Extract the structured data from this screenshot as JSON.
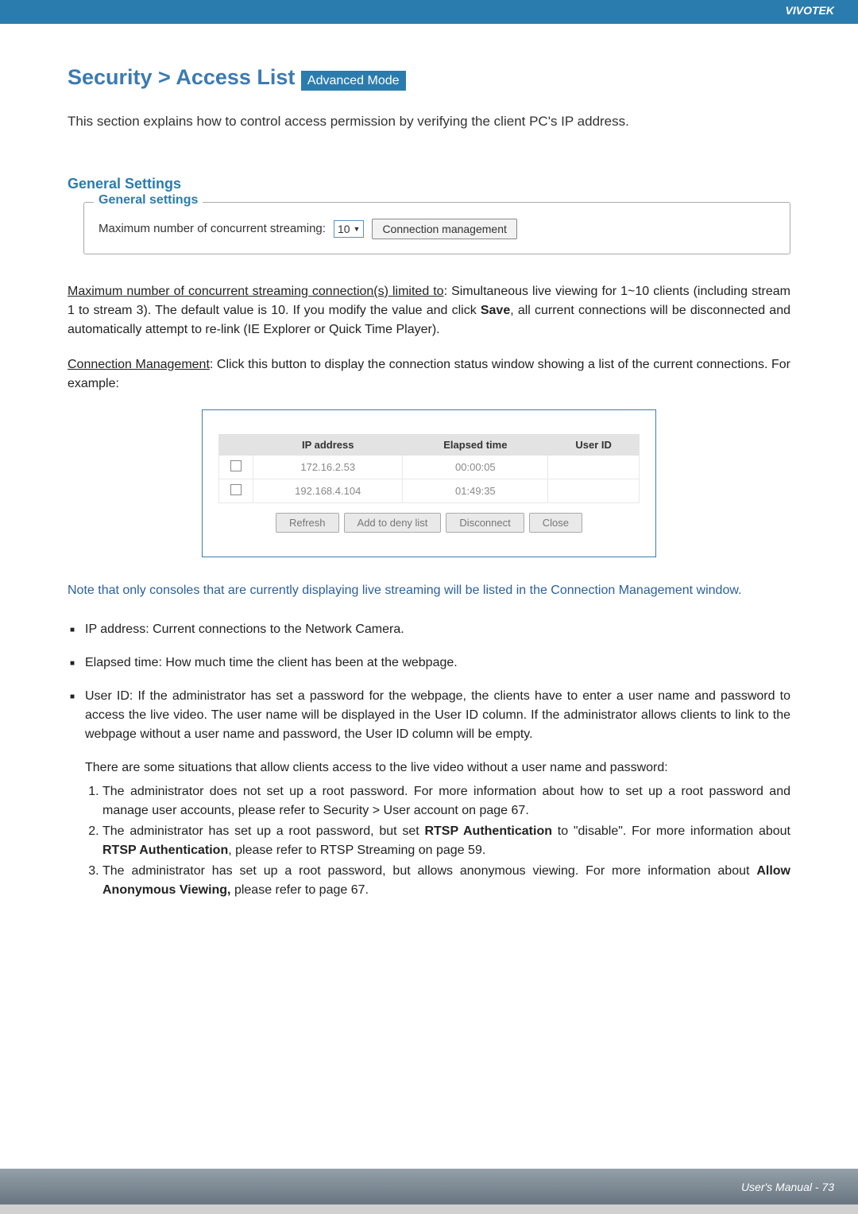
{
  "brand": "VIVOTEK",
  "title_prefix": "Security >  Access List ",
  "adv_mode": "Advanced Mode",
  "intro": "This section explains how to control access permission by verifying the client PC's IP address.",
  "general_settings": {
    "heading": "General Settings",
    "legend": "General settings",
    "label": "Maximum number of concurrent streaming:",
    "value": "10",
    "button": "Connection management"
  },
  "max_para_u": "Maximum number of concurrent streaming connection(s) limited to",
  "max_para_rest": ": Simultaneous live viewing for 1~10 clients (including stream 1 to stream 3). The default value is 10. If you modify the value and click ",
  "save_word": "Save",
  "max_para_tail": ", all current connections will be disconnected and automatically attempt to re-link (IE Explorer or Quick Time Player).",
  "conn_mgmt_u": "Connection Management",
  "conn_mgmt_rest": ": Click this button to display the connection status window showing a list of the current connections. For example:",
  "table": {
    "headers": [
      "",
      "IP address",
      "Elapsed time",
      "User ID"
    ],
    "rows": [
      {
        "ip": "172.16.2.53",
        "elapsed": "00:00:05",
        "user": ""
      },
      {
        "ip": "192.168.4.104",
        "elapsed": "01:49:35",
        "user": ""
      }
    ],
    "buttons": [
      "Refresh",
      "Add to deny list",
      "Disconnect",
      "Close"
    ]
  },
  "note": "Note that only consoles that are currently displaying live streaming will be listed in the Connection Management window.",
  "bullets": {
    "ip": "IP address: Current connections to the Network Camera.",
    "elapsed": "Elapsed time: How much time the client has been at the webpage.",
    "userid": "User ID: If the administrator has set a password for the webpage, the clients have to enter a user name and password to access the live video. The user name will be displayed in the User ID column. If  the administrator allows clients to link to the webpage without a user name and password, the User ID column will be empty."
  },
  "situations_intro": "There are some situations that allow clients access to the live video without a user name and password:",
  "num": {
    "1": "The administrator does not set up a root password. For more information about how to set up a root password and manage user accounts, please refer to Security > User account on page 67.",
    "2a": "The administrator has set up a root password, but set ",
    "2b": "RTSP Authentication",
    "2c": " to \"disable\". For more information about ",
    "2d": "RTSP Authentication",
    "2e": ", please refer to RTSP Streaming on page 59.",
    "3a": "The administrator has set up a root password, but allows anonymous viewing. For more information about ",
    "3b": "Allow Anonymous Viewing,",
    "3c": " please refer to page 67."
  },
  "footer": "User's Manual - 73"
}
